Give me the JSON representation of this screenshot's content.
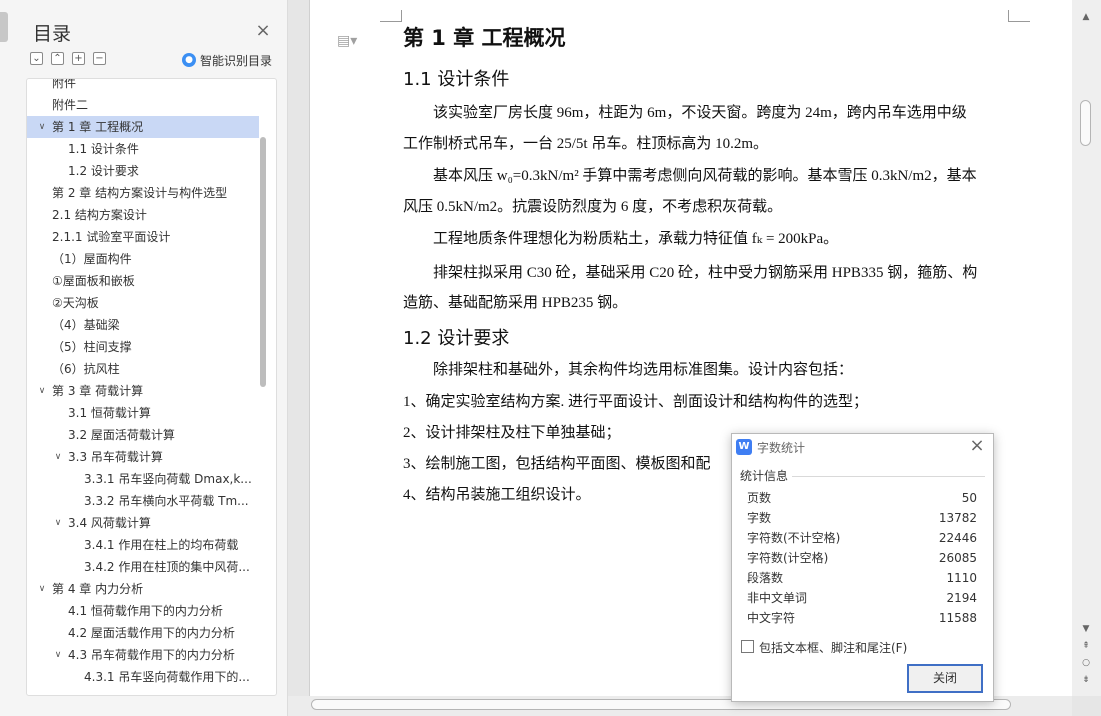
{
  "sidebar": {
    "title": "目录",
    "smart_toc_label": "智能识别目录",
    "items": [
      {
        "label": "附件",
        "level": 1,
        "arrow": ""
      },
      {
        "label": "附件二",
        "level": 1,
        "arrow": ""
      },
      {
        "label": "第 1 章  工程概况",
        "level": 1,
        "arrow": "open",
        "selected": true
      },
      {
        "label": "1.1  设计条件",
        "level": 2,
        "arrow": ""
      },
      {
        "label": "1.2 设计要求",
        "level": 2,
        "arrow": ""
      },
      {
        "label": "第 2 章   结构方案设计与构件选型",
        "level": 1,
        "arrow": ""
      },
      {
        "label": "2.1  结构方案设计",
        "level": 1,
        "arrow": ""
      },
      {
        "label": "2.1.1  试验室平面设计",
        "level": 1,
        "arrow": ""
      },
      {
        "label": "（1）屋面构件",
        "level": 1,
        "arrow": ""
      },
      {
        "label": "①屋面板和嵌板",
        "level": 1,
        "arrow": ""
      },
      {
        "label": "②天沟板",
        "level": 1,
        "arrow": ""
      },
      {
        "label": "（4）基础梁",
        "level": 1,
        "arrow": ""
      },
      {
        "label": "（5）柱间支撑",
        "level": 1,
        "arrow": ""
      },
      {
        "label": "（6）抗风柱",
        "level": 1,
        "arrow": ""
      },
      {
        "label": "第 3 章    荷载计算",
        "level": 1,
        "arrow": "open"
      },
      {
        "label": "3.1  恒荷载计算",
        "level": 2,
        "arrow": ""
      },
      {
        "label": "3.2  屋面活荷载计算",
        "level": 2,
        "arrow": ""
      },
      {
        "label": "3.3  吊车荷载计算",
        "level": 2,
        "arrow": "open"
      },
      {
        "label": "3.3.1  吊车竖向荷载 Dmax,k...",
        "level": 3,
        "arrow": ""
      },
      {
        "label": "3.3.2  吊车横向水平荷载 Tm...",
        "level": 3,
        "arrow": ""
      },
      {
        "label": "3.4    风荷载计算",
        "level": 2,
        "arrow": "open"
      },
      {
        "label": "3.4.1  作用在柱上的均布荷载",
        "level": 3,
        "arrow": ""
      },
      {
        "label": "3.4.2  作用在柱顶的集中风荷...",
        "level": 3,
        "arrow": ""
      },
      {
        "label": "第 4 章    内力分析",
        "level": 1,
        "arrow": "open"
      },
      {
        "label": "4.1  恒荷载作用下的内力分析",
        "level": 2,
        "arrow": ""
      },
      {
        "label": "4.2  屋面活载作用下的内力分析",
        "level": 2,
        "arrow": ""
      },
      {
        "label": "4.3  吊车荷载作用下的内力分析",
        "level": 2,
        "arrow": "open"
      },
      {
        "label": "4.3.1  吊车竖向荷载作用下的...",
        "level": 3,
        "arrow": ""
      }
    ]
  },
  "document": {
    "chapter_title": "第 1 章  工程概况",
    "sec1_title": "1.1  设计条件",
    "para1_line1": "该实验室厂房长度 96m，柱距为 6m，不设天窗。跨度为 24m，跨内吊车选用中级",
    "para1_line2": "工作制桥式吊车，一台 25/5t 吊车。柱顶标高为 10.2m。",
    "para2_line1": "基本风压 w₀=0.3kN/m² 手算中需考虑侧向风荷载的影响。基本雪压 0.3kN/m2，基本",
    "para2_line2": "风压 0.5kN/m2。抗震设防烈度为 6 度，不考虑积灰荷载。",
    "para3_line1": "工程地质条件理想化为粉质粘土，承载力特征值 fₖ = 200kPa。",
    "para4_line1": "排架柱拟采用 C30 砼，基础采用 C20 砼，柱中受力钢筋采用 HPB335 钢，箍筋、构",
    "para4_line2": "造筋、基础配筋采用 HPB235 钢。",
    "sec2_title": "1.2 设计要求",
    "para5_line1": "除排架柱和基础外，其余构件均选用标准图集。设计内容包括：",
    "list1": "1、确定实验室结构方案. 进行平面设计、剖面设计和结构构件的选型；",
    "list2": "2、设计排架柱及柱下单独基础；",
    "list3": "3、绘制施工图，包括结构平面图、模板图和配",
    "list4": "4、结构吊装施工组织设计。"
  },
  "dialog": {
    "title": "字数统计",
    "section_label": "统计信息",
    "stats": [
      {
        "label": "页数",
        "value": "50"
      },
      {
        "label": "字数",
        "value": "13782"
      },
      {
        "label": "字符数(不计空格)",
        "value": "22446"
      },
      {
        "label": "字符数(计空格)",
        "value": "26085"
      },
      {
        "label": "段落数",
        "value": "1110"
      },
      {
        "label": "非中文单词",
        "value": "2194"
      },
      {
        "label": "中文字符",
        "value": "11588"
      }
    ],
    "checkbox_label": "包括文本框、脚注和尾注(F)",
    "checkbox_checked": false,
    "close_button": "关闭"
  }
}
